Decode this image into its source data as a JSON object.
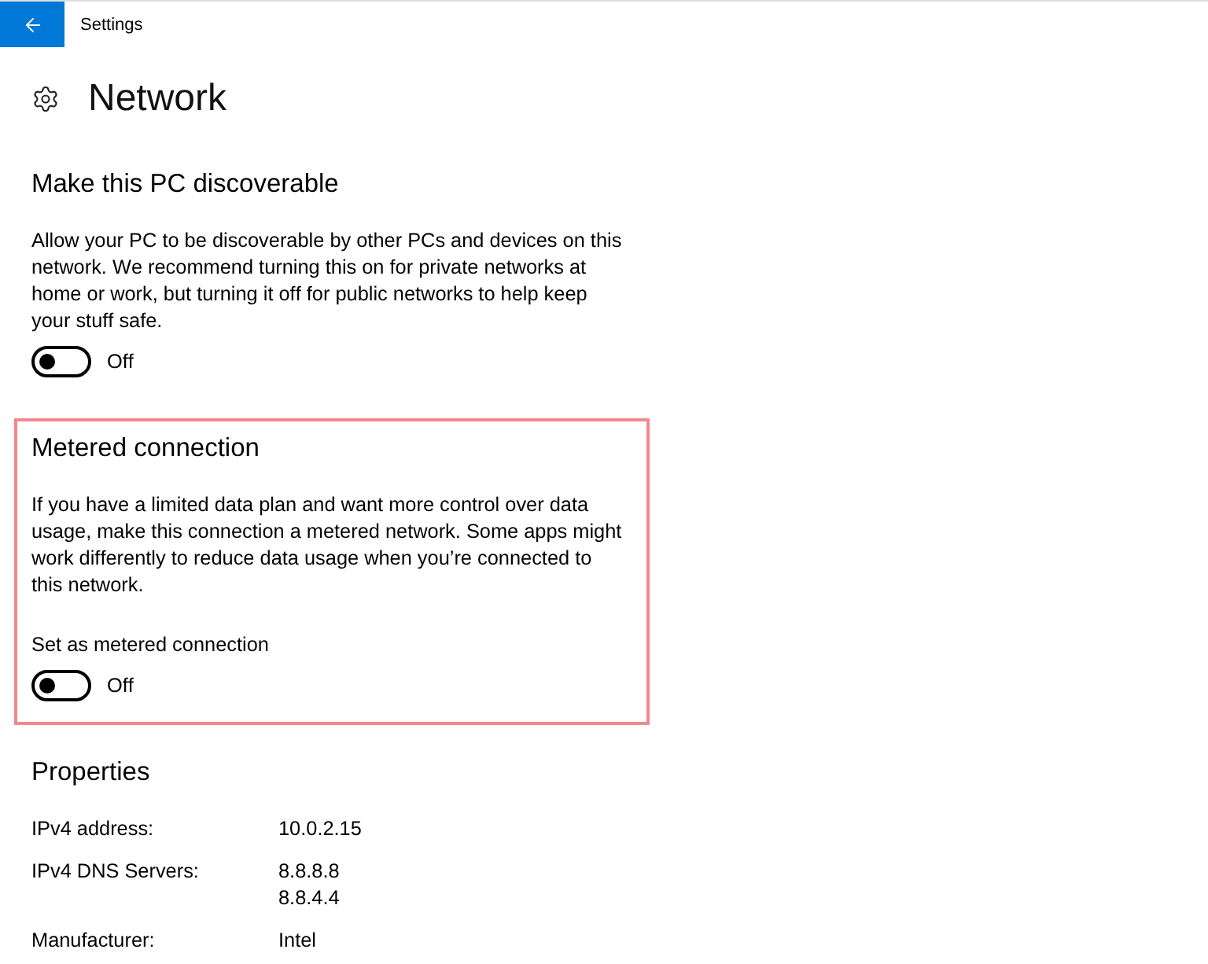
{
  "window": {
    "title": "Settings"
  },
  "page": {
    "title": "Network"
  },
  "sections": [
    {
      "kind": "toggle",
      "highlighted": false,
      "title": "Make this PC discoverable",
      "description": "Allow your PC to be discoverable by other PCs and devices on this network. We recommend turning this on for private networks at home or work, but turning it off for public networks to help keep your stuff safe.",
      "toggle": {
        "on": false,
        "label": "Off"
      }
    },
    {
      "kind": "toggle",
      "highlighted": true,
      "title": "Metered connection",
      "description": "If you have a limited data plan and want more control over data usage, make this connection a metered network. Some apps might work differently to reduce data usage when you’re connected to this network.",
      "setting_label": "Set as metered connection",
      "toggle": {
        "on": false,
        "label": "Off"
      }
    },
    {
      "kind": "properties",
      "highlighted": false,
      "title": "Properties",
      "rows": [
        {
          "label": "IPv4 address:",
          "values": [
            "10.0.2.15"
          ]
        },
        {
          "label": "IPv4 DNS Servers:",
          "values": [
            "8.8.8.8",
            "8.8.4.4"
          ]
        },
        {
          "label": "Manufacturer:",
          "values": [
            "Intel"
          ]
        }
      ]
    }
  ]
}
